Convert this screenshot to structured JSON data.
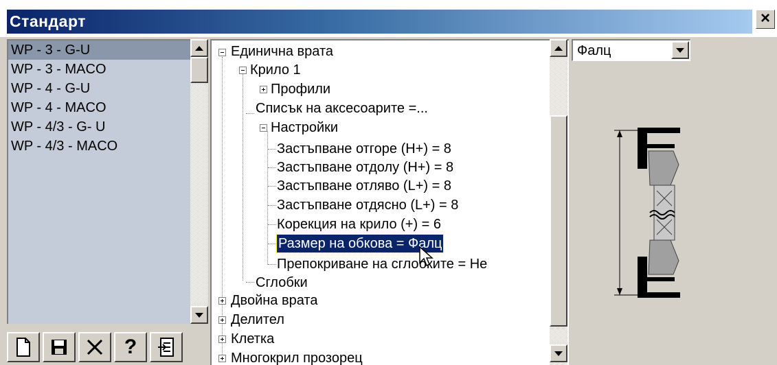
{
  "window": {
    "title": "Стандарт",
    "close_label": "×"
  },
  "standards_list": {
    "items": [
      {
        "label": "WP - 3 - G-U",
        "selected": true
      },
      {
        "label": "WP - 3 - MACO",
        "selected": false
      },
      {
        "label": "WP - 4 - G-U",
        "selected": false
      },
      {
        "label": "WP - 4 - MACO",
        "selected": false
      },
      {
        "label": "WP - 4/3 - G- U",
        "selected": false
      },
      {
        "label": "WP - 4/3 - MACO",
        "selected": false
      }
    ]
  },
  "toolbar": {
    "buttons": [
      "new-document-icon",
      "save-icon",
      "delete-icon",
      "help-icon",
      "import-icon"
    ],
    "help_label": "?"
  },
  "tree": {
    "nodes": [
      {
        "label": "Единична врата"
      },
      {
        "label": "Крило 1"
      },
      {
        "label": "Профили"
      },
      {
        "label": "Списък на аксесоарите =..."
      },
      {
        "label": "Настройки"
      },
      {
        "label": "Застъпване отгоре (H+) =  8"
      },
      {
        "label": "Застъпване отдолу (H+) = 8"
      },
      {
        "label": "Застъпване отляво (L+) = 8"
      },
      {
        "label": "Застъпване отдясно (L+) =  8"
      },
      {
        "label": "Корекция на крило (+) = 6"
      },
      {
        "label": "Размер на обкова = Фалц",
        "selected": true
      },
      {
        "label": "Препокриване на сглобките = Не"
      },
      {
        "label": "Сглобки"
      },
      {
        "label": "Двойна врата"
      },
      {
        "label": "Делител"
      },
      {
        "label": "Клетка"
      },
      {
        "label": "Многокрил прозорец"
      }
    ]
  },
  "dimension_combo": {
    "value": "Фалц"
  },
  "colors": {
    "title_start": "#0a246a",
    "title_end": "#a6caf0",
    "selection": "#0a246a",
    "list_bg": "#c4ccd9",
    "list_selected": "#8a97ab"
  }
}
